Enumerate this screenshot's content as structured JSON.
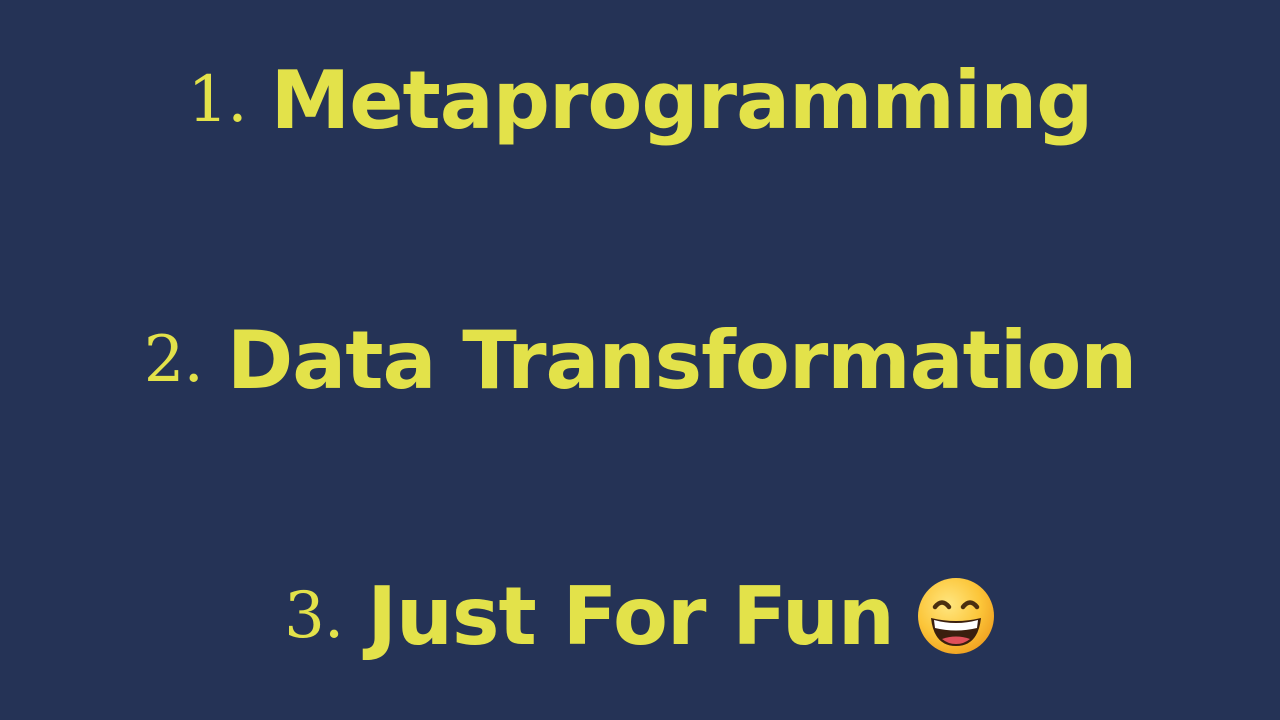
{
  "slide": {
    "background_color": "#253356",
    "text_color": "#e3e24a",
    "items": [
      {
        "number": "1.",
        "label": "Metaprogramming"
      },
      {
        "number": "2.",
        "label": "Data Transformation"
      },
      {
        "number": "3.",
        "label": "Just For Fun",
        "icon": "grinning-face-with-smiling-eyes-icon"
      }
    ]
  }
}
